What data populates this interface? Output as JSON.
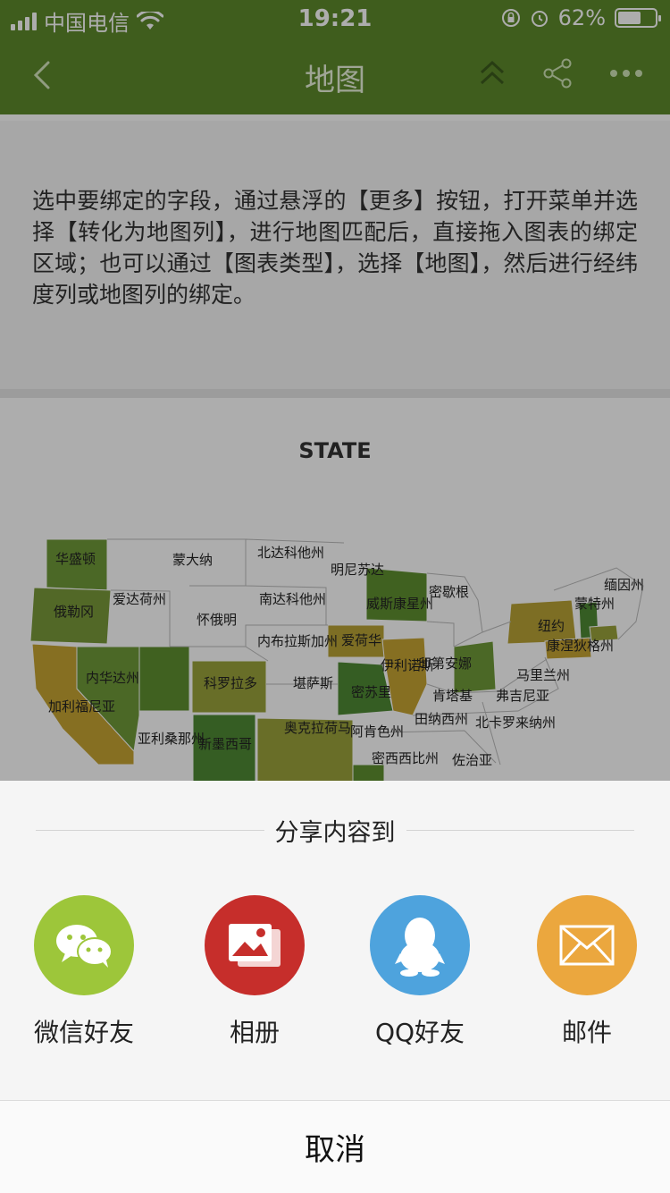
{
  "status_bar": {
    "carrier": "中国电信",
    "time": "19:21",
    "battery": "62%",
    "battery_level": 0.62
  },
  "header": {
    "title": "地图"
  },
  "description": {
    "text": "选中要绑定的字段，通过悬浮的【更多】按钮，打开菜单并选择【转化为地图列】，进行地图匹配后，直接拖入图表的绑定区域；也可以通过【图表类型】，选择【地图】，然后进行经纬度列或地图列的绑定。"
  },
  "map": {
    "title": "STATE",
    "states": [
      {
        "name": "华盛顿"
      },
      {
        "name": "蒙大纳"
      },
      {
        "name": "北达科他州"
      },
      {
        "name": "明尼苏达"
      },
      {
        "name": "缅因州"
      },
      {
        "name": "俄勒冈"
      },
      {
        "name": "爱达荷州"
      },
      {
        "name": "南达科他州"
      },
      {
        "name": "威斯康星州"
      },
      {
        "name": "密歇根"
      },
      {
        "name": "蒙特州"
      },
      {
        "name": "怀俄明"
      },
      {
        "name": "纽约"
      },
      {
        "name": "康涅狄格州"
      },
      {
        "name": "内布拉斯加州"
      },
      {
        "name": "爱荷华"
      },
      {
        "name": "内华达州"
      },
      {
        "name": "科罗拉多"
      },
      {
        "name": "堪萨斯"
      },
      {
        "name": "伊利诺斯"
      },
      {
        "name": "印第安娜"
      },
      {
        "name": "马里兰州"
      },
      {
        "name": "加利福尼亚"
      },
      {
        "name": "密苏里"
      },
      {
        "name": "肯塔基"
      },
      {
        "name": "弗吉尼亚"
      },
      {
        "name": "田纳西州"
      },
      {
        "name": "北卡罗来纳州"
      },
      {
        "name": "亚利桑那州"
      },
      {
        "name": "新墨西哥"
      },
      {
        "name": "奥克拉荷马"
      },
      {
        "name": "阿肯色州"
      },
      {
        "name": "密西西比州"
      },
      {
        "name": "佐治亚"
      }
    ]
  },
  "share": {
    "heading": "分享内容到",
    "items": [
      {
        "label": "微信好友",
        "icon": "wechat-icon",
        "color": "#9dc63a"
      },
      {
        "label": "相册",
        "icon": "photo-album-icon",
        "color": "#c62e2b"
      },
      {
        "label": "QQ好友",
        "icon": "qq-icon",
        "color": "#4ea3dd"
      },
      {
        "label": "邮件",
        "icon": "mail-icon",
        "color": "#eba73e"
      }
    ],
    "cancel": "取消"
  }
}
